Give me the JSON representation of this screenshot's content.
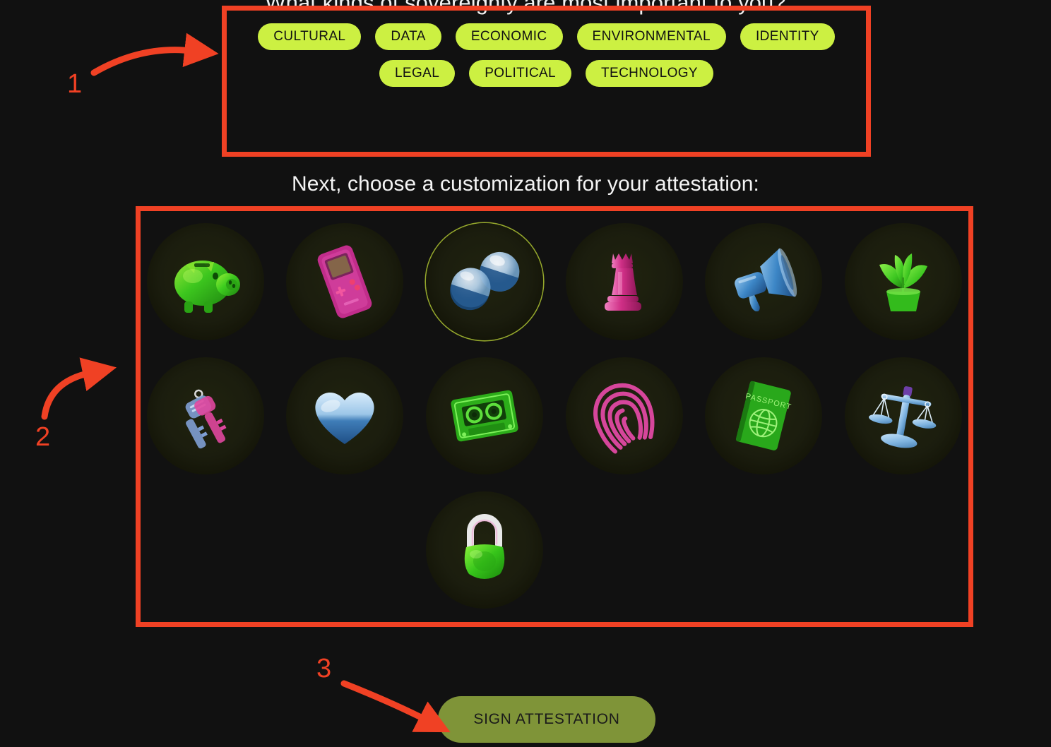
{
  "page": {
    "background_color": "#111111",
    "accent_color": "#ccf042",
    "annotation_color": "#f04124",
    "selection_ring_color": "#95a82c"
  },
  "headings": {
    "question": "What kinds of sovereignty are most important to you?",
    "customization_prompt": "Next, choose a customization for your attestation:"
  },
  "sovereignty_tags": {
    "row_1": [
      {
        "label": "CULTURAL"
      },
      {
        "label": "DATA"
      },
      {
        "label": "ECONOMIC"
      },
      {
        "label": "ENVIRONMENTAL"
      },
      {
        "label": "IDENTITY"
      }
    ],
    "row_2": [
      {
        "label": "LEGAL"
      },
      {
        "label": "POLITICAL"
      },
      {
        "label": "TECHNOLOGY"
      }
    ]
  },
  "customization_icons": [
    {
      "name": "piggy-bank-icon",
      "color": "#3ecf1f",
      "selected": false
    },
    {
      "name": "handheld-console-icon",
      "color": "#d6339b",
      "selected": false
    },
    {
      "name": "hourglass-icon",
      "color": "#7fb4e8",
      "selected": true
    },
    {
      "name": "chess-queen-icon",
      "color": "#d6339b",
      "selected": false
    },
    {
      "name": "megaphone-icon",
      "color": "#4a9ce8",
      "selected": false
    },
    {
      "name": "potted-plant-icon",
      "color": "#44c428",
      "selected": false
    },
    {
      "name": "keys-icon",
      "color": "#8fa8d8",
      "selected": false
    },
    {
      "name": "heart-icon",
      "color": "#6fa8dc",
      "selected": false
    },
    {
      "name": "cassette-tape-icon",
      "color": "#33c425",
      "selected": false
    },
    {
      "name": "fingerprint-icon",
      "color": "#d6469b",
      "selected": false
    },
    {
      "name": "passport-icon",
      "color": "#33bb22",
      "selected": false,
      "label": "PASSPORT"
    },
    {
      "name": "scales-of-justice-icon",
      "color": "#8fc4ea",
      "selected": false
    },
    {
      "name": "padlock-icon",
      "color": "#3ecf1f",
      "selected": false
    }
  ],
  "actions": {
    "sign_attestation_label": "SIGN ATTESTATION"
  },
  "annotations": [
    {
      "number": "1",
      "target": "sovereignty-tags-region"
    },
    {
      "number": "2",
      "target": "customization-icon-grid"
    },
    {
      "number": "3",
      "target": "sign-attestation-button"
    }
  ]
}
